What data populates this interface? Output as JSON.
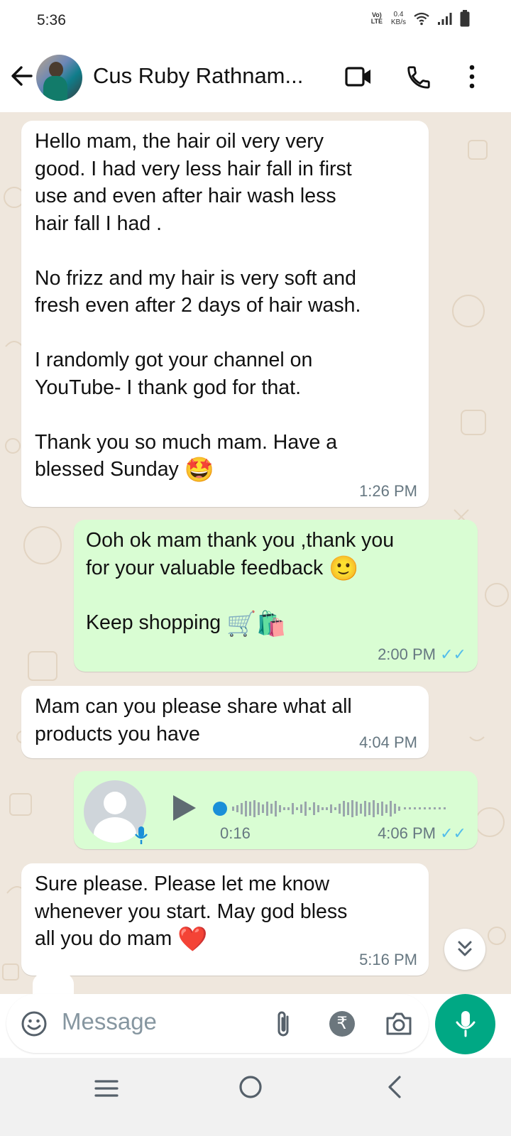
{
  "status_bar": {
    "time": "5:36",
    "volte": "Vo) LTE",
    "speed_value": "0.4",
    "speed_unit": "KB/s"
  },
  "header": {
    "contact_name": "Cus Ruby Rathnam..."
  },
  "messages": [
    {
      "direction": "incoming",
      "text": "Hello mam, the hair oil very very\ngood. I had very less hair fall in first\nuse and even after hair wash less\nhair fall I had .\n\nNo frizz and my hair is very soft and\nfresh even after 2 days of hair wash.\n\nI randomly got your channel on\nYouTube- I thank god for that.\n\nThank you so much mam. Have a\nblessed Sunday",
      "emoji": "🤩",
      "time": "1:26 PM"
    },
    {
      "direction": "outgoing",
      "text_1": "Ooh ok mam thank you ,thank you\nfor your valuable feedback",
      "emoji_1": "🙂",
      "text_2": "Keep shopping",
      "emoji_2": "🛒🛍️",
      "time": "2:00 PM",
      "ticks": "✓✓"
    },
    {
      "direction": "incoming",
      "text": "Mam can you please share what all\nproducts you have",
      "time": "4:04 PM"
    },
    {
      "direction": "outgoing",
      "type": "voice",
      "duration": "0:16",
      "time": "4:06 PM",
      "ticks": "✓✓",
      "progress": 0
    },
    {
      "direction": "incoming",
      "text": "Sure please. Please let me know\nwhenever you start. May god bless\nall you do mam",
      "emoji": "❤️",
      "time": "5:16 PM"
    }
  ],
  "input": {
    "placeholder": "Message"
  },
  "colors": {
    "accent": "#00a884",
    "outgoing_bubble": "#d9fdd3",
    "incoming_bubble": "#ffffff",
    "chat_background": "#efe7dd",
    "read_ticks": "#53bdeb"
  },
  "icons": [
    "back-arrow-icon",
    "video-call-icon",
    "phone-call-icon",
    "more-options-icon",
    "play-icon",
    "microphone-icon",
    "emoji-icon",
    "attachment-icon",
    "rupee-payment-icon",
    "camera-icon",
    "scroll-down-icon",
    "menu-nav-icon",
    "home-nav-icon",
    "back-nav-icon"
  ]
}
